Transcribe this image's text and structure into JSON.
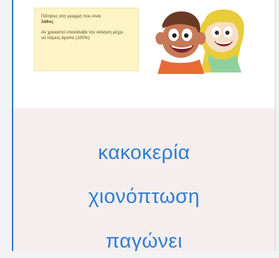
{
  "feedback": {
    "line_1": "Πάτησες στη γραμμή που είναι",
    "answer_label": "λάθος",
    "retry_text": "Αν χρειαστεί επανάλαβε την άσκηση μέχρι να πάρεις άριστα (100%)"
  },
  "answers": [
    {
      "text": "κακοκερία"
    },
    {
      "text": "χιονόπτωση"
    },
    {
      "text": "παγώνει"
    }
  ],
  "colors": {
    "answer_text": "#2f7ed2",
    "panel_bg": "#f6eeee",
    "note_bg": "#fdf4c6"
  },
  "icons": {
    "boy": "cartoon-boy-icon",
    "girl": "cartoon-girl-icon"
  }
}
